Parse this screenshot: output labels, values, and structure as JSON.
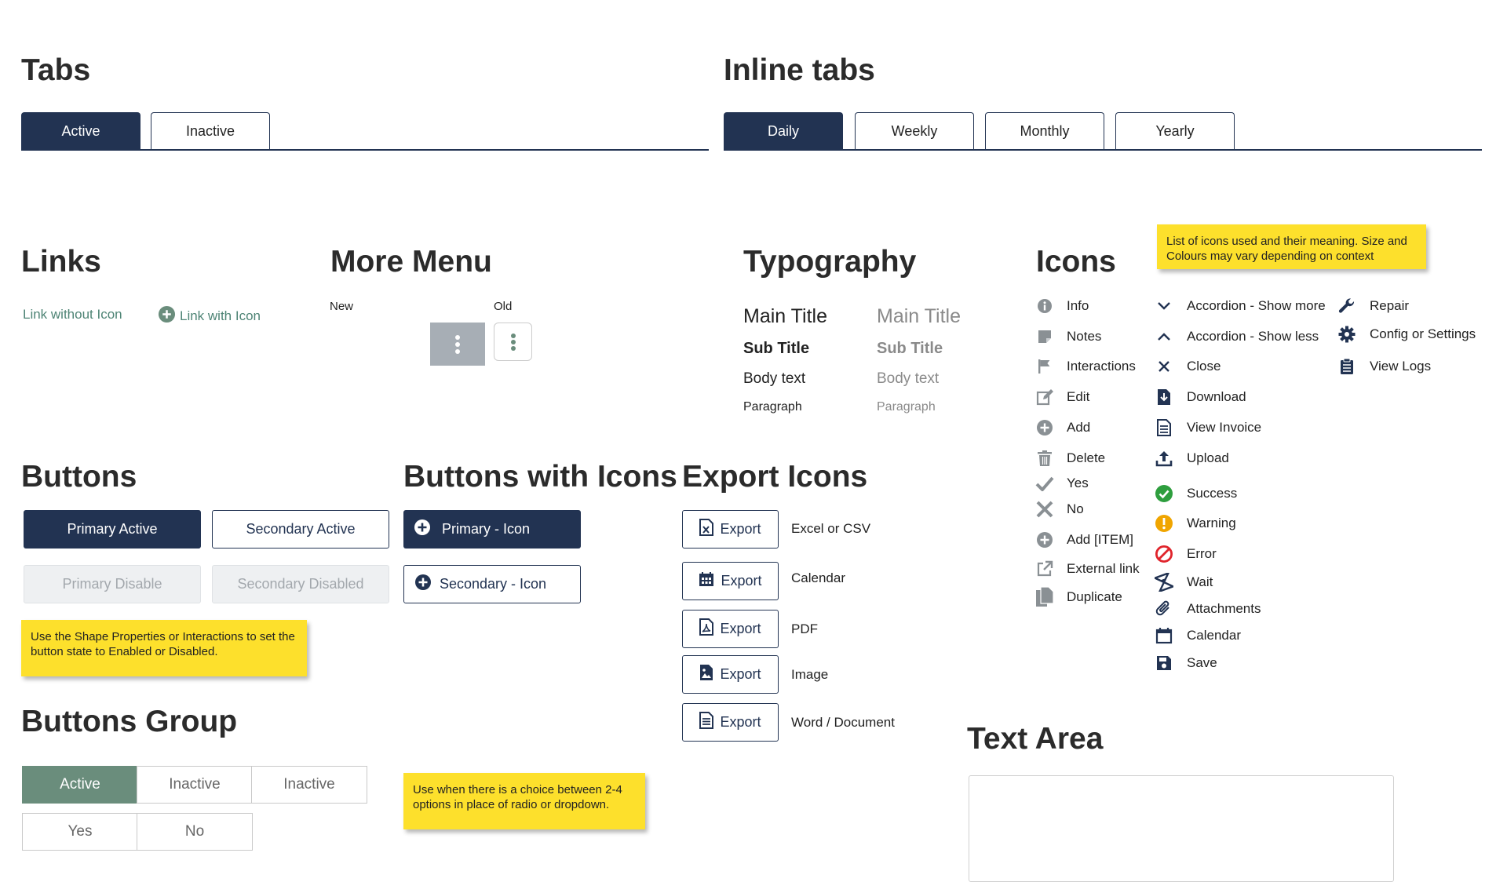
{
  "tabs": {
    "title": "Tabs",
    "items": [
      "Active",
      "Inactive"
    ]
  },
  "inline_tabs": {
    "title": "Inline tabs",
    "items": [
      "Daily",
      "Weekly",
      "Monthly",
      "Yearly"
    ]
  },
  "links": {
    "title": "Links",
    "no_icon": "Link without Icon",
    "with_icon": "Link with Icon"
  },
  "more_menu": {
    "title": "More Menu",
    "new_label": "New",
    "old_label": "Old"
  },
  "typography": {
    "title": "Typography",
    "main_title": "Main Title",
    "sub_title": "Sub Title",
    "body_text": "Body text",
    "paragraph": "Paragraph"
  },
  "icons": {
    "title": "Icons",
    "note": "List of icons used and their meaning. Size and Colours may vary depending on context",
    "col1": [
      {
        "icon": "info-icon",
        "label": "Info"
      },
      {
        "icon": "notes-icon",
        "label": "Notes"
      },
      {
        "icon": "flag-icon",
        "label": "Interactions"
      },
      {
        "icon": "edit-icon",
        "label": "Edit"
      },
      {
        "icon": "add-icon",
        "label": "Add"
      },
      {
        "icon": "trash-icon",
        "label": "Delete"
      },
      {
        "icon": "check-icon",
        "label": "Yes"
      },
      {
        "icon": "x-icon",
        "label": "No"
      },
      {
        "icon": "add-item-icon",
        "label": "Add [ITEM]"
      },
      {
        "icon": "external-link-icon",
        "label": "External link"
      },
      {
        "icon": "duplicate-icon",
        "label": "Duplicate"
      }
    ],
    "col2": [
      {
        "icon": "chevron-down-icon",
        "label": "Accordion - Show more"
      },
      {
        "icon": "chevron-up-icon",
        "label": "Accordion - Show less"
      },
      {
        "icon": "close-icon",
        "label": "Close"
      },
      {
        "icon": "download-icon",
        "label": "Download"
      },
      {
        "icon": "invoice-icon",
        "label": "View Invoice"
      },
      {
        "icon": "upload-icon",
        "label": "Upload"
      },
      {
        "icon": "success-icon",
        "label": "Success"
      },
      {
        "icon": "warning-icon",
        "label": "Warning"
      },
      {
        "icon": "error-icon",
        "label": "Error"
      },
      {
        "icon": "wait-icon",
        "label": "Wait"
      },
      {
        "icon": "paperclip-icon",
        "label": "Attachments"
      },
      {
        "icon": "calendar-icon",
        "label": "Calendar"
      },
      {
        "icon": "save-icon",
        "label": "Save"
      }
    ],
    "col3": [
      {
        "icon": "wrench-icon",
        "label": "Repair"
      },
      {
        "icon": "gear-icon",
        "label": "Config or Settings"
      },
      {
        "icon": "clipboard-icon",
        "label": "View Logs"
      }
    ]
  },
  "buttons": {
    "title": "Buttons",
    "primary_active": "Primary Active",
    "secondary_active": "Secondary Active",
    "primary_disabled": "Primary Disable",
    "secondary_disabled": "Secondary Disabled",
    "note": "Use the Shape Properties or Interactions to set the button state to Enabled or Disabled."
  },
  "buttons_icons": {
    "title": "Buttons with Icons",
    "primary": "Primary - Icon",
    "secondary": "Secondary - Icon"
  },
  "export": {
    "title": "Export Icons",
    "button_label": "Export",
    "items": [
      {
        "icon": "excel-file-icon",
        "label": "Excel or CSV"
      },
      {
        "icon": "calendar-grid-icon",
        "label": "Calendar"
      },
      {
        "icon": "pdf-file-icon",
        "label": "PDF"
      },
      {
        "icon": "image-file-icon",
        "label": "Image"
      },
      {
        "icon": "word-file-icon",
        "label": "Word / Document"
      }
    ]
  },
  "buttons_group": {
    "title": "Buttons Group",
    "row1": [
      "Active",
      "Inactive",
      "Inactive"
    ],
    "row2": [
      "Yes",
      "No"
    ],
    "note": "Use when there is a choice between 2-4 options in place of radio or dropdown."
  },
  "text_area": {
    "title": "Text Area",
    "value": ""
  },
  "colors": {
    "navy": "#223352",
    "green": "#6a8d7c",
    "link": "#4e8475",
    "grey_icon": "#8a9094",
    "success": "#2e9e3e",
    "warning": "#f0a500",
    "error": "#e0242b"
  }
}
